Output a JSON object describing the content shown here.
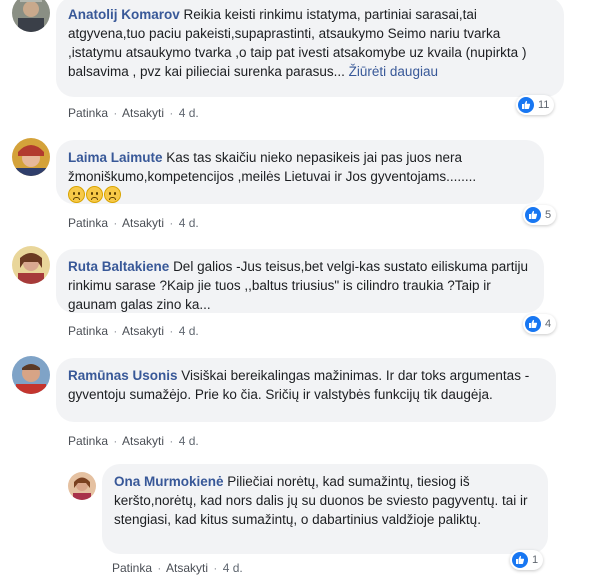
{
  "comments": [
    {
      "author": "Anatolij Komarov",
      "text": "Reikia keisti rinkimu istatyma, partiniai sarasai,tai atgyvena,tuo paciu pakeisti,supaprastinti, atsaukymo Seimo nariu tvarka ,istatymu atsaukymo tvarka ,o taip pat ivesti atsakomybe uz kvaila (nupirkta ) balsavima , pvz kai pilieciai surenka parasus...",
      "see_more": "Žiūrėti daugiau",
      "like": "Patinka",
      "reply": "Atsakyti",
      "time": "4 d.",
      "reactions": "11"
    },
    {
      "author": "Laima Laimute",
      "text": "Kas tas skaičiu nieko nepasikeis jai pas juos nera žmoniškumo,kompetencijos ,meilės Lietuvai ir Jos gyventojams........",
      "like": "Patinka",
      "reply": "Atsakyti",
      "time": "4 d.",
      "reactions": "5",
      "emoji": [
        "crying-face-emoji",
        "crying-face-emoji",
        "crying-face-emoji"
      ]
    },
    {
      "author": "Ruta Baltakiene",
      "text": "Del galios -Jus teisus,bet velgi-kas sustato eiliskuma partiju rinkimu sarase ?Kaip jie tuos ,,baltus triusius\" is cilindro traukia ?Taip ir gaunam galas zino ka...",
      "like": "Patinka",
      "reply": "Atsakyti",
      "time": "4 d.",
      "reactions": "4"
    },
    {
      "author": "Ramūnas Usonis",
      "text": "Visiškai bereikalingas mažinimas. Ir dar toks argumentas - gyventoju sumažėjo. Prie ko čia. Sričių ir valstybės funkcijų tik daugėja.",
      "like": "Patinka",
      "reply": "Atsakyti",
      "time": "4 d."
    },
    {
      "author": "Ona Murmokienė",
      "text": "Piliečiai norėtų, kad sumažintų, tiesiog iš keršto,norėtų, kad nors dalis jų su duonos be sviesto pagyventų. tai ir stengiasi, kad kitus sumažintų, o dabartinius valdžioje paliktų.",
      "like": "Patinka",
      "reply": "Atsakyti",
      "time": "4 d.",
      "reactions": "1"
    }
  ],
  "separator": "·",
  "colors": {
    "name": "#385898",
    "bubble": "#f2f3f5",
    "like_blue": "#1877f2"
  }
}
